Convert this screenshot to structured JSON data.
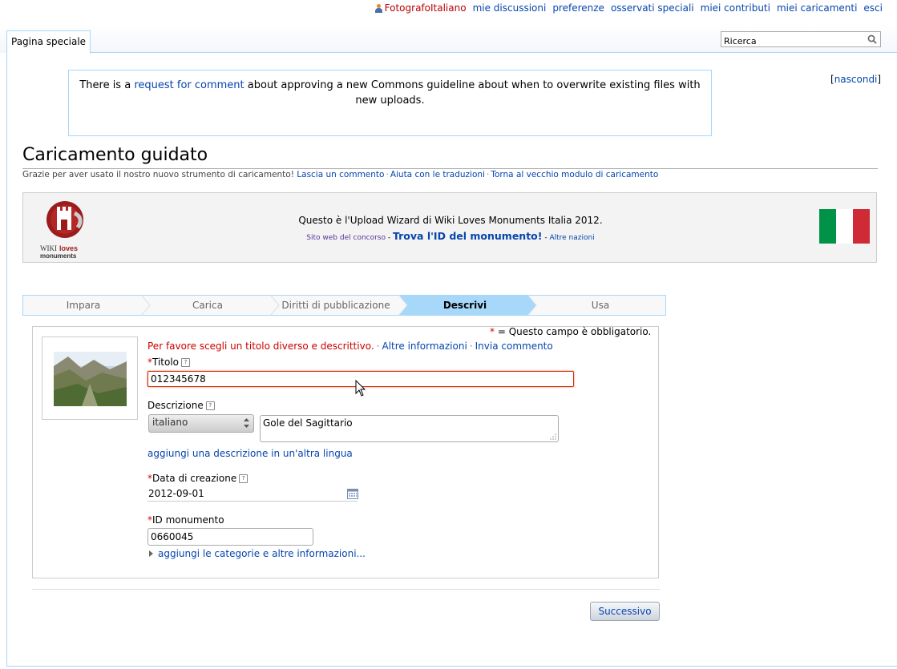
{
  "personal_bar": {
    "user": "FotografoItaliano",
    "links": [
      "mie discussioni",
      "preferenze",
      "osservati speciali",
      "miei contributi",
      "miei caricamenti",
      "esci"
    ]
  },
  "header": {
    "tab_label": "Pagina speciale",
    "search_value": "Ricerca"
  },
  "notice": {
    "text_before": "There is a ",
    "link_text": "request for comment",
    "text_after": " about approving a new Commons guideline about when to overwrite existing files with new uploads.",
    "hide_label": "nascondi"
  },
  "page": {
    "title": "Caricamento guidato",
    "subtitle_text": "Grazie per aver usato il nostro nuovo strumento di caricamento!",
    "subtitle_links": [
      "Lascia un commento",
      "Aiuta con le traduzioni",
      "Torna al vecchio modulo di caricamento"
    ]
  },
  "banner": {
    "logo_text_wiki": "WIKI",
    "logo_text_loves": "loves",
    "logo_text_monuments": "monuments",
    "headline": "Questo è l'Upload Wizard di Wiki Loves Monuments Italia 2012.",
    "site_link": "Sito web del concorso",
    "find_id_link": "Trova l'ID del monumento!",
    "other_nations_link": "Altre nazioni",
    "flag_colors": [
      "#009246",
      "#ffffff",
      "#ce2b37"
    ]
  },
  "steps": [
    "Impara",
    "Carica",
    "Diritti di pubblicazione",
    "Descrivi",
    "Usa"
  ],
  "active_step": "Descrivi",
  "form": {
    "required_note": "= Questo campo è obbligatorio.",
    "error_text": "Per favore scegli un titolo diverso e descrittivo.",
    "more_info_link": "Altre informazioni",
    "send_comment_link": "Invia commento",
    "title_label": "Titolo",
    "title_value": "012345678",
    "description_label": "Descrizione",
    "language_value": "italiano",
    "description_value": "Gole del Sagittario",
    "add_language_link": "aggiungi una descrizione in un'altra lingua",
    "date_label": "Data di creazione",
    "date_value": "2012-09-01",
    "monument_label": "ID monumento",
    "monument_value": "0660045",
    "more_categories_link": "aggiungi le categorie e altre informazioni..."
  },
  "buttons": {
    "next": "Successivo"
  },
  "colors": {
    "link": "#0645ad",
    "error": "#cc0000",
    "border_blue": "#a7d7f9"
  }
}
